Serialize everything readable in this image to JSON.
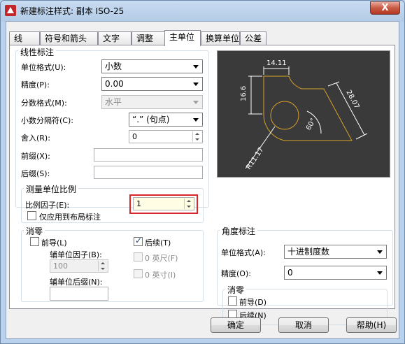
{
  "window": {
    "title": "新建标注样式: 副本 ISO-25",
    "close_glyph": "X"
  },
  "tabs": [
    {
      "label": "线"
    },
    {
      "label": "符号和箭头"
    },
    {
      "label": "文字"
    },
    {
      "label": "调整"
    },
    {
      "label": "主单位",
      "active": true
    },
    {
      "label": "换算单位"
    },
    {
      "label": "公差"
    }
  ],
  "linear": {
    "title": "线性标注",
    "unit_format_label": "单位格式(U):",
    "unit_format_value": "小数",
    "precision_label": "精度(P):",
    "precision_value": "0.00",
    "fraction_format_label": "分数格式(M):",
    "fraction_format_value": "水平",
    "decimal_sep_label": "小数分隔符(C):",
    "decimal_sep_value": "“.” (句点)",
    "round_off_label": "舍入(R):",
    "round_off_value": "0",
    "prefix_label": "前缀(X):",
    "prefix_value": "",
    "suffix_label": "后缀(S):",
    "suffix_value": ""
  },
  "scale": {
    "title": "测量单位比例",
    "factor_label": "比例因子(E):",
    "factor_value": "1",
    "layout_only_label": "仅应用到布局标注",
    "layout_only_checked": false
  },
  "zero_suppression": {
    "title": "消零",
    "leading_label": "前导(L)",
    "leading_checked": false,
    "trailing_label": "后续(T)",
    "trailing_checked": true,
    "sub_factor_label": "辅单位因子(B):",
    "sub_factor_value": "100",
    "sub_suffix_label": "辅单位后缀(N):",
    "sub_suffix_value": "",
    "feet_label": "0 英尺(F)",
    "inches_label": "0 英寸(I)"
  },
  "preview": {
    "dim_top": "14.11",
    "dim_left": "16.6",
    "dim_right": "28.07",
    "dim_angle": "60°",
    "dim_radius": "R11.17",
    "colors": {
      "background": "#3a3a3a",
      "geometry": "#d9a12a",
      "dimension": "#ffffff"
    }
  },
  "angular": {
    "title": "角度标注",
    "unit_format_label": "单位格式(A):",
    "unit_format_value": "十进制度数",
    "precision_label": "精度(O):",
    "precision_value": "0",
    "zero_title": "消零",
    "leading_label": "前导(D)",
    "leading_checked": false,
    "trailing_label": "后续(N)",
    "trailing_checked": false
  },
  "buttons": {
    "ok": "确定",
    "cancel": "取消",
    "help": "帮助(H)"
  },
  "highlight_color": "#d9262b"
}
